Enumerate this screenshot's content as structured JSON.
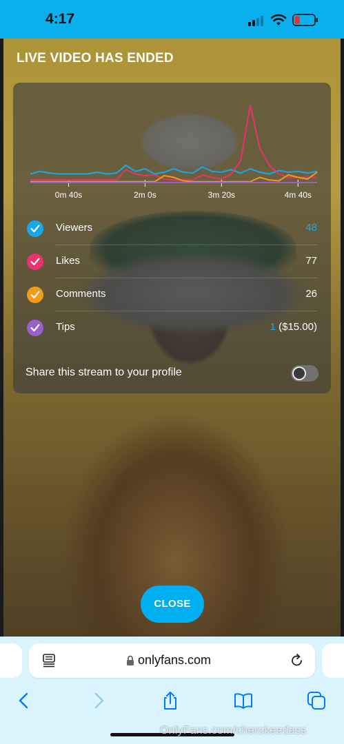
{
  "status_bar": {
    "time": "4:17"
  },
  "stream": {
    "title": "LIVE VIDEO HAS ENDED",
    "close_label": "CLOSE",
    "share_label": "Share this stream to your profile",
    "share_enabled": false
  },
  "chart_data": {
    "type": "line",
    "title": "",
    "xlabel": "",
    "ylabel": "",
    "x": [
      0,
      10,
      20,
      30,
      40,
      50,
      60,
      70,
      80,
      90,
      100,
      110,
      120,
      130,
      140,
      150,
      160,
      170,
      180,
      190,
      200,
      210,
      220,
      230,
      240,
      250,
      260,
      270,
      280,
      290,
      300
    ],
    "x_ticks": [
      {
        "value": 40,
        "label": "0m 40s"
      },
      {
        "value": 120,
        "label": "2m 0s"
      },
      {
        "value": 200,
        "label": "3m 20s"
      },
      {
        "value": 280,
        "label": "4m 40s"
      }
    ],
    "xlim": [
      0,
      300
    ],
    "ylim": [
      0,
      10
    ],
    "grid": true,
    "series": [
      {
        "name": "Viewers",
        "color": "#18a7e8",
        "values": [
          1,
          1.3,
          1.1,
          1,
          1,
          1,
          1,
          1.2,
          1,
          1.1,
          2,
          1.3,
          1.6,
          1,
          1.2,
          1.6,
          1.2,
          1.1,
          1.8,
          1.3,
          1.2,
          1.5,
          1.1,
          1.6,
          1.2,
          1,
          1.4,
          1.2,
          1.3,
          1.1,
          1.3
        ]
      },
      {
        "name": "Likes",
        "color": "#e8336d",
        "values": [
          0.3,
          0.3,
          0.3,
          0.3,
          0.3,
          0.3,
          0.3,
          0.3,
          0.3,
          0.3,
          1.5,
          1,
          0.8,
          0.9,
          0.4,
          0.3,
          0.3,
          0.3,
          0.9,
          0.6,
          0.4,
          1,
          2.5,
          9,
          4,
          2,
          1,
          0.6,
          0.6,
          0.6,
          0.6
        ]
      },
      {
        "name": "Comments",
        "color": "#f39a17",
        "values": [
          0.1,
          0.1,
          0.1,
          0.1,
          0.1,
          0.1,
          0.1,
          0.1,
          0.1,
          0.1,
          0.1,
          0.1,
          0.1,
          0.1,
          0.8,
          0.6,
          0.2,
          0.1,
          0.1,
          0.1,
          0.1,
          0.1,
          0.1,
          0.1,
          0.6,
          0.3,
          0.2,
          0.9,
          0.6,
          0.4,
          1.2
        ]
      },
      {
        "name": "Tips",
        "color": "#9a5fc8",
        "values": [
          0,
          0,
          0,
          0,
          0,
          0,
          0,
          0,
          0,
          0,
          0,
          0,
          0,
          0,
          0,
          0,
          0,
          0,
          0,
          0,
          0,
          0,
          0,
          0,
          0,
          0,
          0,
          0,
          0,
          0,
          0
        ]
      }
    ]
  },
  "stats": [
    {
      "label": "Viewers",
      "value": "48",
      "value_suffix": "",
      "color": "#18a7e8",
      "value_accent": true
    },
    {
      "label": "Likes",
      "value": "77",
      "value_suffix": "",
      "color": "#e8336d",
      "value_accent": false
    },
    {
      "label": "Comments",
      "value": "26",
      "value_suffix": "",
      "color": "#f39a17",
      "value_accent": false
    },
    {
      "label": "Tips",
      "value": "1",
      "value_suffix": " ($15.00)",
      "color": "#9a5fc8",
      "value_accent": true
    }
  ],
  "browser": {
    "url": "onlyfans.com"
  },
  "watermark": "OnlyFans.com/cherokeedass"
}
